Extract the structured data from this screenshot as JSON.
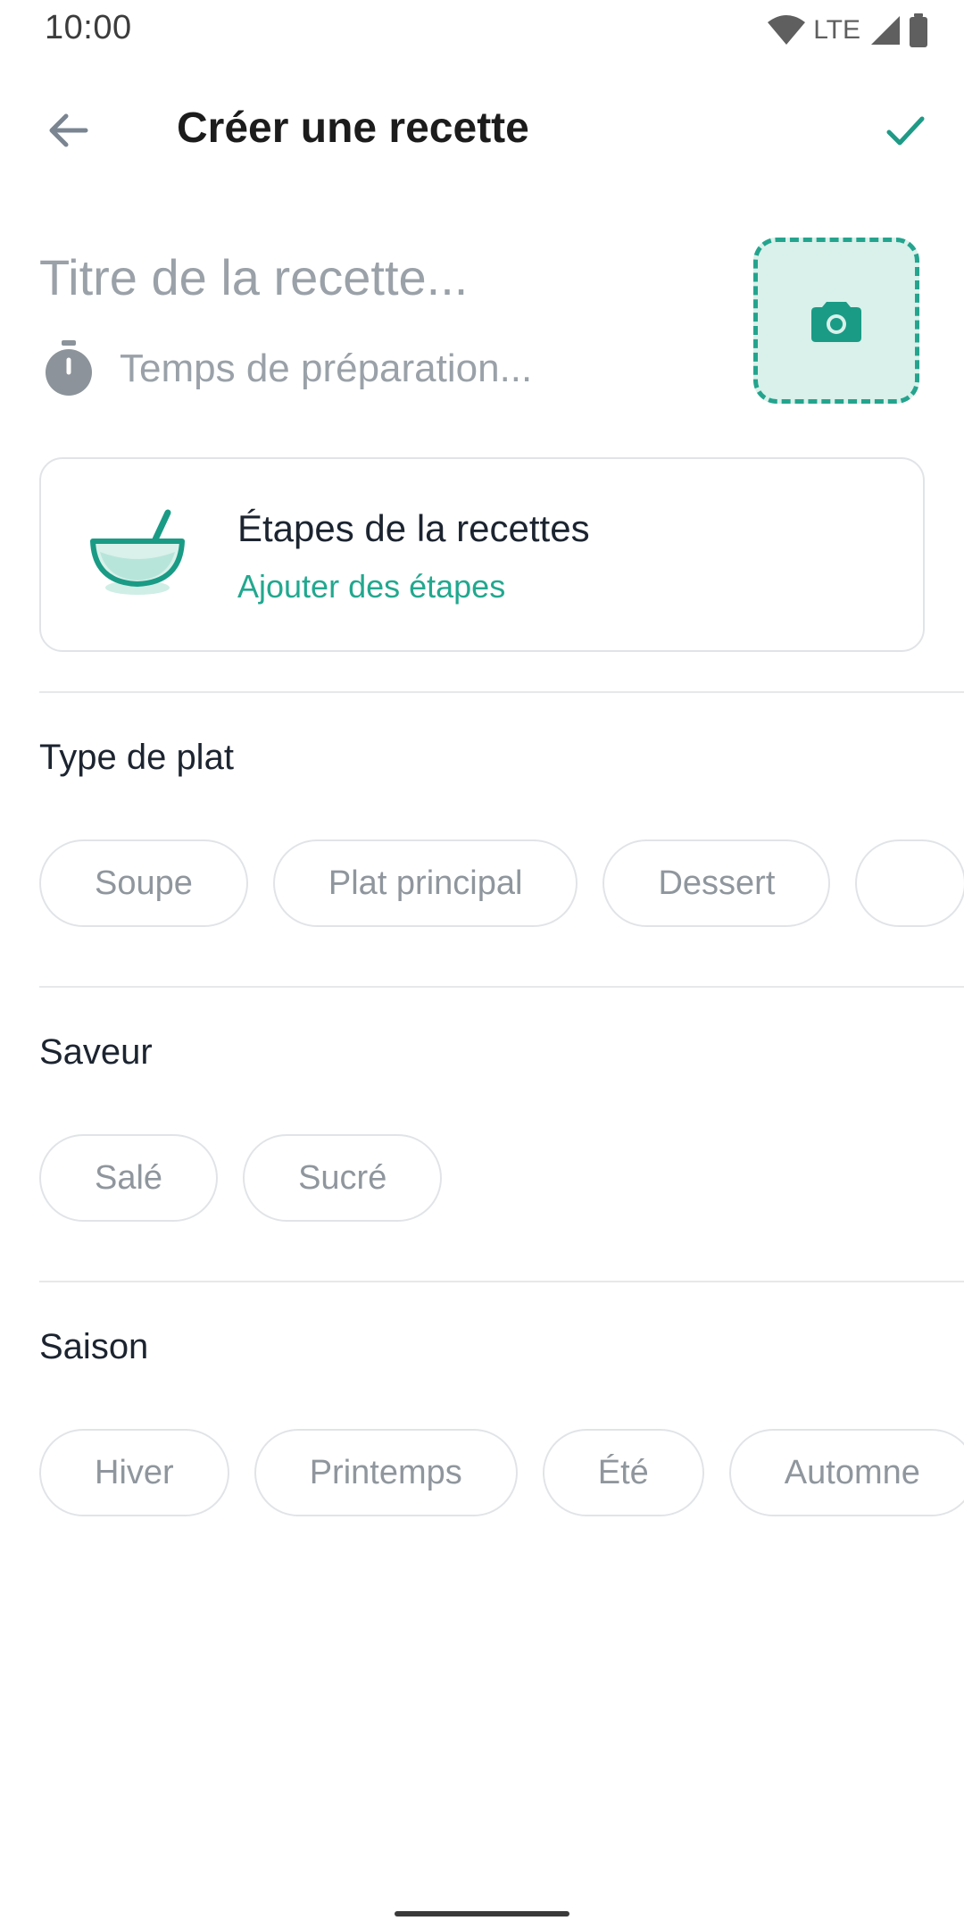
{
  "status_bar": {
    "time": "10:00",
    "network": "LTE"
  },
  "header": {
    "title": "Créer une recette",
    "back_icon": "arrow-back-icon",
    "confirm_icon": "check-icon"
  },
  "form": {
    "title_placeholder": "Titre de la recette...",
    "prep_time_placeholder": "Temps de préparation...",
    "photo_icon": "camera-icon"
  },
  "steps_card": {
    "title": "Étapes de la recettes",
    "link": "Ajouter des étapes"
  },
  "sections": {
    "type": {
      "title": "Type de plat",
      "chips": [
        "Soupe",
        "Plat principal",
        "Dessert",
        ""
      ]
    },
    "saveur": {
      "title": "Saveur",
      "chips": [
        "Salé",
        "Sucré"
      ]
    },
    "saison": {
      "title": "Saison",
      "chips": [
        "Hiver",
        "Printemps",
        "Été",
        "Automne"
      ]
    }
  },
  "colors": {
    "accent": "#22a88f",
    "photo_bg": "#d9f1ea",
    "placeholder": "#9aa1a8",
    "chip_text": "#8f969d"
  }
}
